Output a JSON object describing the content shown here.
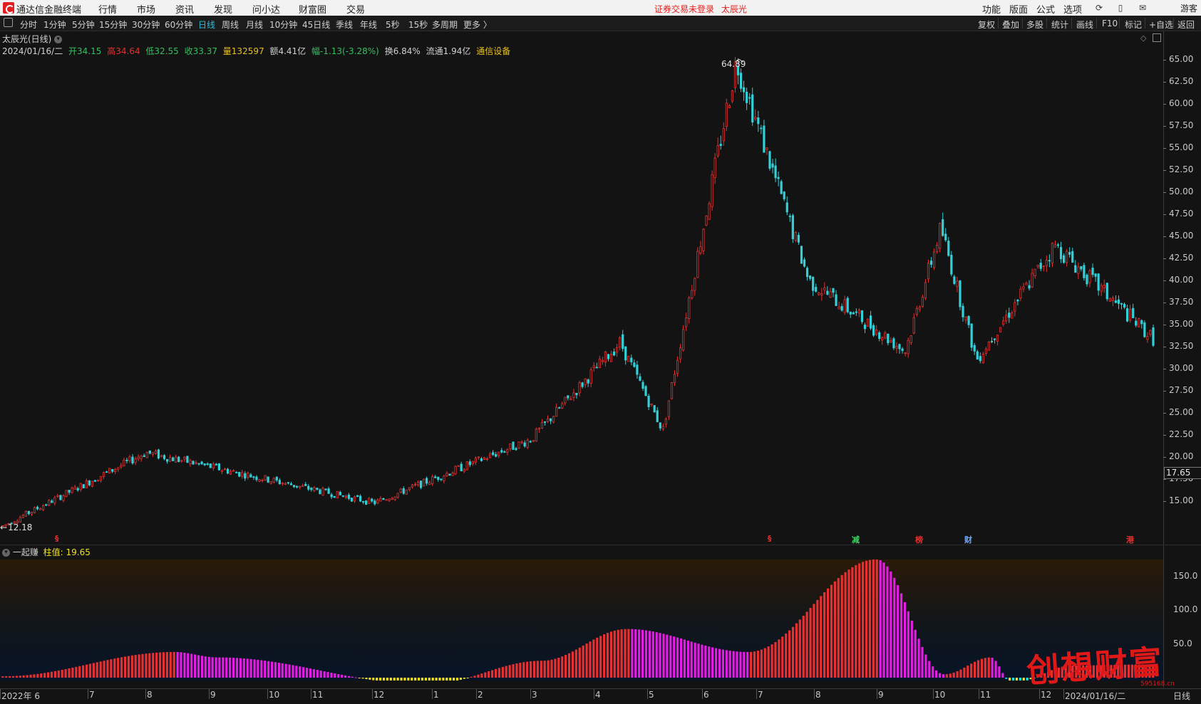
{
  "app": {
    "title": "通达信金融终端"
  },
  "menu": [
    "行情",
    "市场",
    "资讯",
    "发现",
    "问小达",
    "财富圈",
    "交易"
  ],
  "alert": {
    "login": "证券交易未登录",
    "stock": "太辰光"
  },
  "right_menu": [
    "功能",
    "版面",
    "公式",
    "选项"
  ],
  "right_icons": [
    "refresh-icon",
    "phone-icon",
    "mail-icon"
  ],
  "user": "游客",
  "periods": [
    "分时",
    "1分钟",
    "5分钟",
    "15分钟",
    "30分钟",
    "60分钟",
    "日线",
    "周线",
    "月线",
    "10分钟",
    "45日线",
    "季线",
    "年线",
    "5秒",
    "15秒",
    "多周期",
    "更多 〉"
  ],
  "active_period": "日线",
  "toolbar_right": [
    "复权",
    "叠加",
    "多股",
    "统计",
    "画线",
    "F10",
    "标记",
    "+自选",
    "返回"
  ],
  "stock": {
    "name": "太辰光(日线)",
    "date": "2024/01/16/二",
    "open_label": "开34.15",
    "high_label": "高34.64",
    "low_label": "低32.55",
    "close_label": "收33.37",
    "volume_label": "量132597",
    "amount_label": "额4.41亿",
    "change_label": "幅-1.13(-3.28%)",
    "turnover_label": "换6.84%",
    "float_label": "流通1.94亿",
    "sector": "通信设备",
    "max_label": "64.89",
    "min_label": "12.18",
    "last_price": "17.65"
  },
  "colors": {
    "up": "#e83030",
    "down": "#34d0d8",
    "magenta": "#e41ce4",
    "cyan": "#20e0e8",
    "yellow": "#f0e020",
    "accent": "#2bbfe0"
  },
  "main_axis": [
    "65.00",
    "62.50",
    "60.00",
    "57.50",
    "55.00",
    "52.50",
    "50.00",
    "47.50",
    "45.00",
    "42.50",
    "40.00",
    "37.50",
    "35.00",
    "32.50",
    "30.00",
    "27.50",
    "25.00",
    "22.50",
    "20.00",
    "17.50",
    "15.00"
  ],
  "event_tags": [
    {
      "text": "§",
      "color": "#e83030"
    },
    {
      "text": "§",
      "color": "#e83030"
    },
    {
      "text": "减",
      "color": "#40d060"
    },
    {
      "text": "榜",
      "color": "#e83030"
    },
    {
      "text": "财",
      "color": "#6fa8ff"
    },
    {
      "text": "港",
      "color": "#e83030"
    }
  ],
  "indicator": {
    "name": "一起赚",
    "value_label": "柱值: 19.65",
    "axis": [
      "150.0",
      "100.0",
      "50.0"
    ]
  },
  "x_labels": [
    "2022年 6",
    "7",
    "8",
    "9",
    "10",
    "11",
    "12",
    "1",
    "2",
    "3",
    "4",
    "5",
    "6",
    "7",
    "8",
    "9",
    "10",
    "11",
    "12",
    "2024/01/16/二",
    "日线"
  ],
  "watermark": {
    "text": "创想财富",
    "url": "595168.cn"
  },
  "chart_data": {
    "type": "candlestick",
    "title": "太辰光(日线)",
    "ylim": [
      11,
      67
    ],
    "key_points": [
      {
        "label": "2022-06",
        "close": 12.18
      },
      {
        "label": "2022-08",
        "close": 20.5
      },
      {
        "label": "2022-12",
        "close": 14.8
      },
      {
        "label": "2023-03",
        "close": 22.0
      },
      {
        "label": "2023-04",
        "close": 33.0
      },
      {
        "label": "2023-05",
        "close": 23.0
      },
      {
        "label": "2023-06",
        "close": 64.89
      },
      {
        "label": "2023-08",
        "close": 40.0
      },
      {
        "label": "2023-09",
        "close": 32.0
      },
      {
        "label": "2023-10",
        "close": 46.0
      },
      {
        "label": "2023-11",
        "close": 31.0
      },
      {
        "label": "2023-12",
        "close": 44.0
      },
      {
        "label": "2024-01-16",
        "close": 33.37
      }
    ],
    "indicator_series": {
      "name": "一起赚",
      "ylim": [
        -10,
        180
      ],
      "key_points": [
        {
          "label": "2022-06",
          "value": 2
        },
        {
          "label": "2022-08",
          "value": 38
        },
        {
          "label": "2022-09",
          "value": 30
        },
        {
          "label": "2022-12",
          "value": -10
        },
        {
          "label": "2023-03",
          "value": 25
        },
        {
          "label": "2023-04",
          "value": 72
        },
        {
          "label": "2023-05",
          "value": 38
        },
        {
          "label": "2023-07",
          "value": 175
        },
        {
          "label": "2023-09",
          "value": 5
        },
        {
          "label": "2023-10",
          "value": 30
        },
        {
          "label": "2023-11",
          "value": -8
        },
        {
          "label": "2023-12",
          "value": 18
        },
        {
          "label": "2024-01-16",
          "value": 19.65
        }
      ]
    }
  }
}
